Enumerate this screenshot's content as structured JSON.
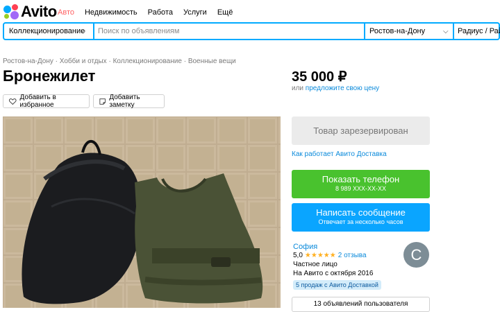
{
  "header": {
    "logo_text": "Avito",
    "nav": [
      {
        "label": "Авто",
        "active": true
      },
      {
        "label": "Недвижимость",
        "active": false
      },
      {
        "label": "Работа",
        "active": false
      },
      {
        "label": "Услуги",
        "active": false
      },
      {
        "label": "Ещё",
        "active": false
      }
    ]
  },
  "search": {
    "category": "Коллекционирование",
    "placeholder": "Поиск по объявлениям",
    "location": "Ростов-на-Дону",
    "radius": "Радиус / Район"
  },
  "breadcrumb": [
    "Ростов-на-Дону",
    "Хобби и отдых",
    "Коллекционирование",
    "Военные вещи"
  ],
  "breadcrumb_sep": "·",
  "listing": {
    "title": "Бронежилет",
    "price": "35 000 ₽",
    "price_prefix": "или",
    "price_link": "предложите свою цену",
    "add_favorite": "Добавить в избранное",
    "add_note": "Добавить заметку"
  },
  "actions": {
    "reserved": "Товар зарезервирован",
    "delivery_link": "Как работает Авито Доставка",
    "phone_label": "Показать телефон",
    "phone_number": "8 989 XXX-XX-XX",
    "message_label": "Написать сообщение",
    "message_sub": "Отвечает за несколько часов"
  },
  "seller": {
    "name": "София",
    "rating": "5,0",
    "stars": "★★★★★",
    "reviews": "2 отзыва",
    "type": "Частное лицо",
    "since": "На Авито с октября 2016",
    "badge": "5 продаж с Авито Доставкой",
    "avatar_letter": "C",
    "ads_button": "13 объявлений пользователя"
  },
  "colors": {
    "accent_blue": "#00aaff",
    "link_blue": "#0a8adb",
    "green_button": "#49c22e",
    "blue_button": "#0aa5ff",
    "nav_active": "#ff6163"
  }
}
